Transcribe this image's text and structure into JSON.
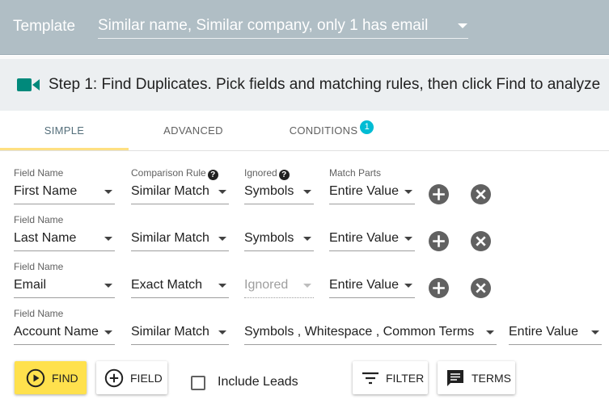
{
  "template": {
    "label": "Template",
    "value": "Similar name, Similar company, only 1 has email"
  },
  "step": {
    "icon": "video-camera-icon",
    "text": "Step 1: Find Duplicates. Pick fields and matching rules, then click Find to analyze"
  },
  "tabs": [
    {
      "label": "SIMPLE",
      "active": true
    },
    {
      "label": "ADVANCED",
      "active": false
    },
    {
      "label": "CONDITIONS",
      "active": false,
      "badge": "1"
    }
  ],
  "headers": {
    "field_name": "Field Name",
    "comparison_rule": "Comparison Rule",
    "ignored": "Ignored",
    "match_parts": "Match Parts",
    "help": "?"
  },
  "rows": [
    {
      "field_label": "Field Name",
      "field": "First Name",
      "rule": "Similar Match",
      "ignored": "Symbols",
      "match": "Entire Value"
    },
    {
      "field_label": "Field Name",
      "field": "Last Name",
      "rule": "Similar Match",
      "ignored": "Symbols",
      "match": "Entire Value"
    },
    {
      "field_label": "Field Name",
      "field": "Email",
      "rule": "Exact Match",
      "ignored": "Ignored",
      "match": "Entire Value"
    },
    {
      "field_label": "Field Name",
      "field": "Account Name",
      "rule": "Similar Match",
      "ignored": "Symbols , Whitespace , Common Terms",
      "match": "Entire Value"
    }
  ],
  "actions": {
    "find": "FIND",
    "field": "FIELD",
    "include_leads": "Include Leads",
    "filter": "FILTER",
    "terms": "TERMS"
  },
  "colors": {
    "template_bar": "#b0bec5",
    "step_bar": "#eceff1",
    "accent_icon": "#00897b",
    "badge": "#00bcd4",
    "find_button": "#ffe14d",
    "tab_underline": "#ffe082"
  }
}
